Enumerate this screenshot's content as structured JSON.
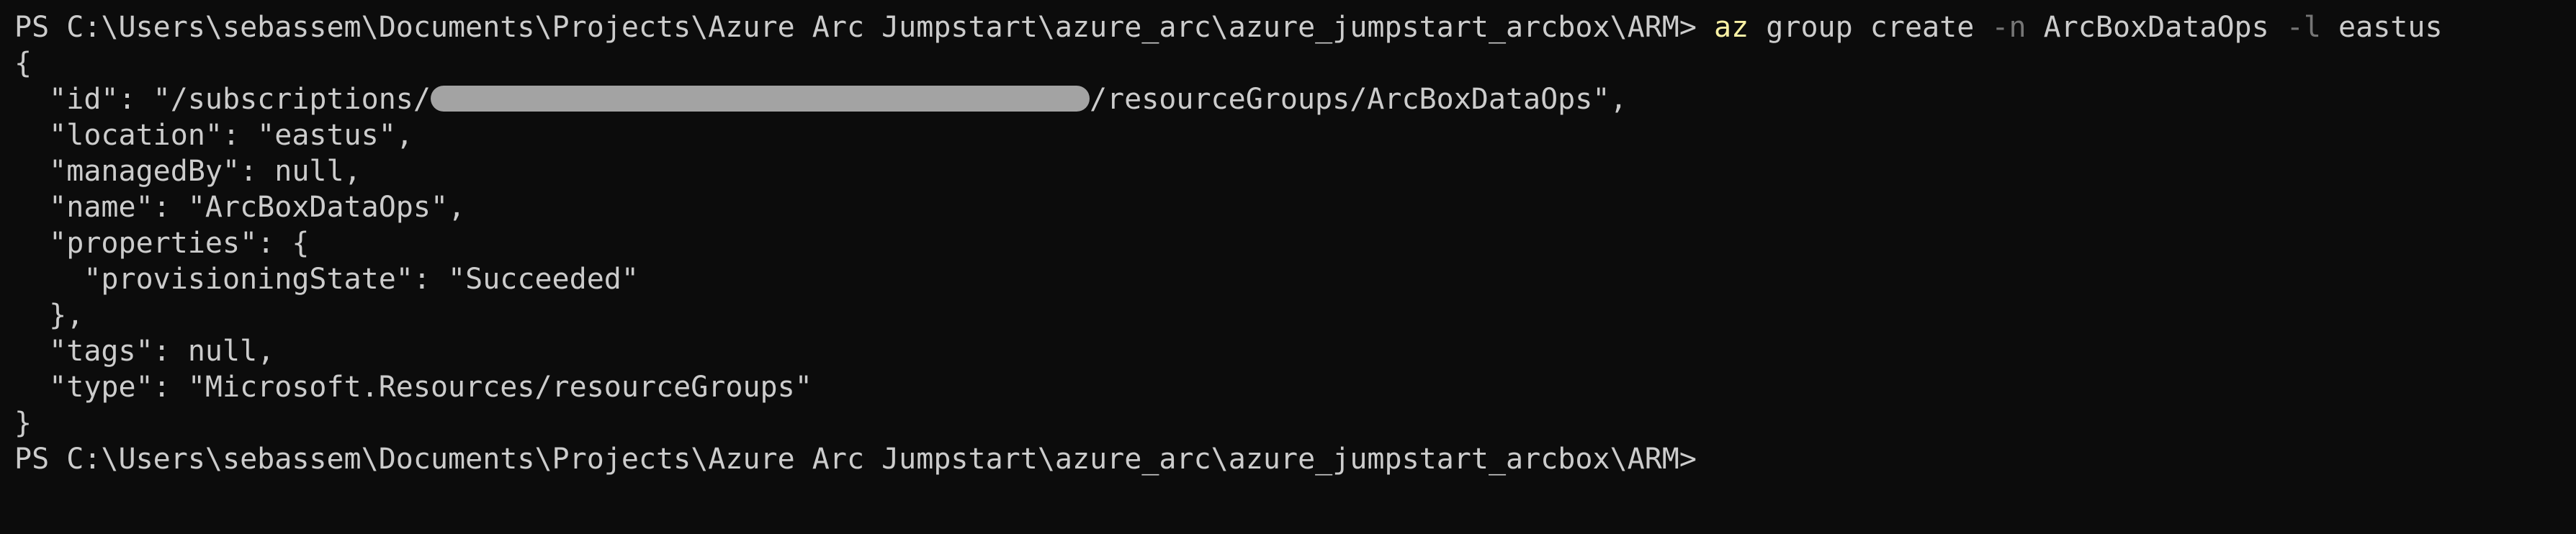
{
  "window": {
    "background": "#0c0c0c",
    "foreground": "#cccccc",
    "command_color": "#f9f1a5",
    "flag_color": "#767676",
    "redaction_color": "#a3a3a3"
  },
  "prompt1": {
    "text": "PS C:\\Users\\sebassem\\Documents\\Projects\\Azure Arc Jumpstart\\azure_arc\\azure_jumpstart_arcbox\\ARM> ",
    "command": "az",
    "subcommand": " group create ",
    "flag_n": "-n",
    "value_n": " ArcBoxDataOps ",
    "flag_l": "-l",
    "value_l": " eastus"
  },
  "output": {
    "open_brace": "{",
    "id_prefix": "  \"id\": \"/subscriptions/",
    "id_suffix": "/resourceGroups/ArcBoxDataOps\",",
    "location": "  \"location\": \"eastus\",",
    "managedBy": "  \"managedBy\": null,",
    "name": "  \"name\": \"ArcBoxDataOps\",",
    "properties_open": "  \"properties\": {",
    "provisioningState": "    \"provisioningState\": \"Succeeded\"",
    "properties_close": "  },",
    "tags": "  \"tags\": null,",
    "type": "  \"type\": \"Microsoft.Resources/resourceGroups\"",
    "close_brace": "}"
  },
  "prompt2": {
    "text": "PS C:\\Users\\sebassem\\Documents\\Projects\\Azure Arc Jumpstart\\azure_arc\\azure_jumpstart_arcbox\\ARM>"
  }
}
